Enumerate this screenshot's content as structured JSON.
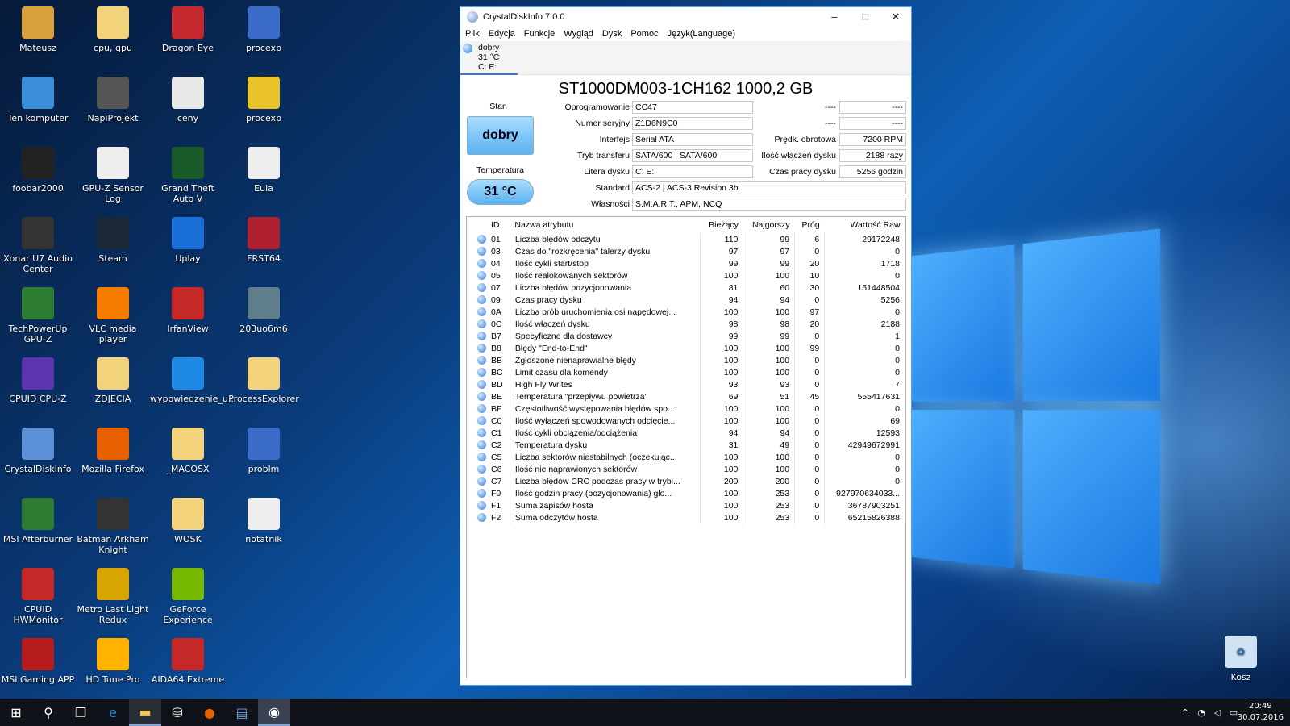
{
  "desktop": {
    "icons": [
      [
        "Mateusz",
        "#d9a13b"
      ],
      [
        "cpu, gpu",
        "#f2d27a"
      ],
      [
        "Dragon Eye",
        "#c4272d"
      ],
      [
        "procexp",
        "#3b6cc9"
      ],
      [
        "Ten komputer",
        "#3b8fd9"
      ],
      [
        "NapiProjekt",
        "#555"
      ],
      [
        "ceny",
        "#e8e8e8"
      ],
      [
        "procexp",
        "#e9c329"
      ],
      [
        "foobar2000",
        "#222"
      ],
      [
        "GPU-Z Sensor Log",
        "#eee"
      ],
      [
        "Grand Theft Auto V",
        "#1a5b2a"
      ],
      [
        "Eula",
        "#eee"
      ],
      [
        "Xonar U7 Audio Center",
        "#333"
      ],
      [
        "Steam",
        "#1b2838"
      ],
      [
        "Uplay",
        "#1a6ed8"
      ],
      [
        "FRST64",
        "#b02030"
      ],
      [
        "TechPowerUp GPU-Z",
        "#2e7d32"
      ],
      [
        "VLC media player",
        "#f57c00"
      ],
      [
        "IrfanView",
        "#c62828"
      ],
      [
        "203uo6m6",
        "#607d8b"
      ],
      [
        "CPUID CPU-Z",
        "#5e35b1"
      ],
      [
        "ZDJĘCIA",
        "#f2d27a"
      ],
      [
        "wypowiedzenie_u...",
        "#1e88e5"
      ],
      [
        "ProcessExplorer",
        "#f2d27a"
      ],
      [
        "CrystalDiskInfo",
        "#5b8fd6"
      ],
      [
        "Mozilla Firefox",
        "#e66000"
      ],
      [
        "_MACOSX",
        "#f2d27a"
      ],
      [
        "problm",
        "#3b6cc9"
      ],
      [
        "MSI Afterburner",
        "#2e7d32"
      ],
      [
        "Batman Arkham Knight",
        "#333"
      ],
      [
        "WOSK",
        "#f2d27a"
      ],
      [
        "notatnik",
        "#eee"
      ],
      [
        "CPUID HWMonitor",
        "#c62828"
      ],
      [
        "Metro Last Light Redux",
        "#d8a400"
      ],
      [
        "GeForce Experience",
        "#76b900"
      ],
      [],
      [
        "MSI Gaming APP",
        "#b71c1c"
      ],
      [
        "HD Tune Pro",
        "#ffb300"
      ],
      [
        "AIDA64 Extreme",
        "#c62828"
      ],
      []
    ],
    "recycle": "Kosz"
  },
  "window": {
    "title": "CrystalDiskInfo 7.0.0",
    "controls": {
      "min": "–",
      "max": "□",
      "close": "✕"
    }
  },
  "menu": [
    "Plik",
    "Edycja",
    "Funkcje",
    "Wygląd",
    "Dysk",
    "Pomoc",
    "Język(Language)"
  ],
  "disk_tab": {
    "status": "dobry",
    "temp": "31 °C",
    "drives": "C: E:"
  },
  "model": "ST1000DM003-1CH162 1000,2 GB",
  "health": {
    "label": "Stan",
    "value": "dobry",
    "color": "#5bb2f0"
  },
  "temperature": {
    "label": "Temperatura",
    "value": "31 °C"
  },
  "info": {
    "firmware": {
      "label": "Oprogramowanie",
      "value": "CC47"
    },
    "serial": {
      "label": "Numer seryjny",
      "value": "Z1D6N9C0"
    },
    "interface": {
      "label": "Interfejs",
      "value": "Serial ATA"
    },
    "transfer": {
      "label": "Tryb transferu",
      "value": "SATA/600 | SATA/600"
    },
    "letter": {
      "label": "Litera dysku",
      "value": "C: E:"
    },
    "standard": {
      "label": "Standard",
      "value": "ACS-2 | ACS-3 Revision 3b"
    },
    "features": {
      "label": "Własności",
      "value": "S.M.A.R.T., APM, NCQ"
    },
    "r1": {
      "label": "----",
      "value": "----"
    },
    "r2": {
      "label": "----",
      "value": "----"
    },
    "rpm": {
      "label": "Prędk. obrotowa",
      "value": "7200 RPM"
    },
    "count": {
      "label": "Ilość włączeń dysku",
      "value": "2188 razy"
    },
    "hours": {
      "label": "Czas pracy dysku",
      "value": "5256 godzin"
    }
  },
  "smart": {
    "headers": [
      "ID",
      "Nazwa atrybutu",
      "Bieżący",
      "Najgorszy",
      "Próg",
      "Wartość Raw"
    ],
    "rows": [
      [
        "01",
        "Liczba błędów odczytu",
        "110",
        "99",
        "6",
        "29172248"
      ],
      [
        "03",
        "Czas do \"rozkręcenia\" talerzy dysku",
        "97",
        "97",
        "0",
        "0"
      ],
      [
        "04",
        "Ilość cykli start/stop",
        "99",
        "99",
        "20",
        "1718"
      ],
      [
        "05",
        "Ilość realokowanych sektorów",
        "100",
        "100",
        "10",
        "0"
      ],
      [
        "07",
        "Liczba błędów pozycjonowania",
        "81",
        "60",
        "30",
        "151448504"
      ],
      [
        "09",
        "Czas pracy dysku",
        "94",
        "94",
        "0",
        "5256"
      ],
      [
        "0A",
        "Liczba prób uruchomienia osi napędowej...",
        "100",
        "100",
        "97",
        "0"
      ],
      [
        "0C",
        "Ilość włączeń dysku",
        "98",
        "98",
        "20",
        "2188"
      ],
      [
        "B7",
        "Specyficzne dla dostawcy",
        "99",
        "99",
        "0",
        "1"
      ],
      [
        "B8",
        "Błędy \"End-to-End\"",
        "100",
        "100",
        "99",
        "0"
      ],
      [
        "BB",
        "Zgłoszone nienaprawialne błędy",
        "100",
        "100",
        "0",
        "0"
      ],
      [
        "BC",
        "Limit czasu dla komendy",
        "100",
        "100",
        "0",
        "0"
      ],
      [
        "BD",
        "High Fly Writes",
        "93",
        "93",
        "0",
        "7"
      ],
      [
        "BE",
        "Temperatura \"przepływu powietrza\"",
        "69",
        "51",
        "45",
        "555417631"
      ],
      [
        "BF",
        "Częstotliwość występowania błędów spo...",
        "100",
        "100",
        "0",
        "0"
      ],
      [
        "C0",
        "Ilość wyłączeń spowodowanych odcięcie...",
        "100",
        "100",
        "0",
        "69"
      ],
      [
        "C1",
        "Ilość cykli obciążenia/odciążenia",
        "94",
        "94",
        "0",
        "12593"
      ],
      [
        "C2",
        "Temperatura dysku",
        "31",
        "49",
        "0",
        "42949672991"
      ],
      [
        "C5",
        "Liczba sektorów niestabilnych (oczekując...",
        "100",
        "100",
        "0",
        "0"
      ],
      [
        "C6",
        "Ilość nie naprawionych sektorów",
        "100",
        "100",
        "0",
        "0"
      ],
      [
        "C7",
        "Liczba błędów CRC podczas pracy w trybi...",
        "200",
        "200",
        "0",
        "0"
      ],
      [
        "F0",
        "Ilość godzin pracy (pozycjonowania) gło...",
        "100",
        "253",
        "0",
        "927970634033..."
      ],
      [
        "F1",
        "Suma zapisów hosta",
        "100",
        "253",
        "0",
        "36787903251"
      ],
      [
        "F2",
        "Suma odczytów hosta",
        "100",
        "253",
        "0",
        "65215826388"
      ]
    ]
  },
  "tray": {
    "time": "20:49",
    "date": "30.07.2016"
  }
}
